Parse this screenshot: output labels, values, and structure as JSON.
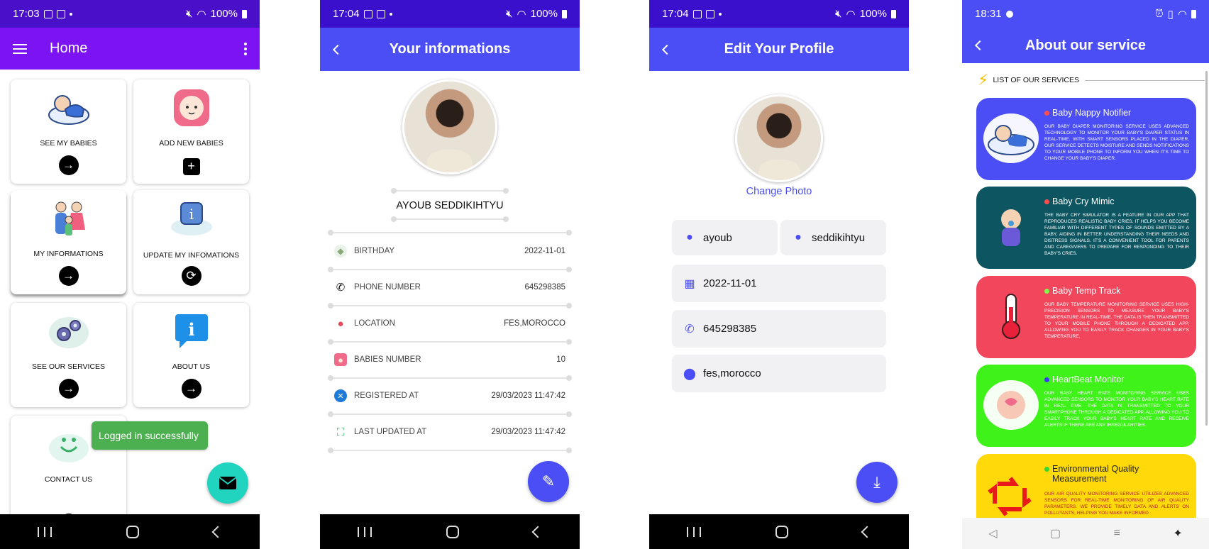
{
  "screen1": {
    "status": {
      "time": "17:03",
      "battery": "100%"
    },
    "title": "Home",
    "cards": [
      {
        "label": "SEE MY BABIES",
        "icon": "baby-sleeping-icon",
        "action": "arrow-right-icon"
      },
      {
        "label": "ADD NEW BABIES",
        "icon": "baby-face-icon",
        "action": "plus-box-icon"
      },
      {
        "label": "MY INFORMATIONS",
        "icon": "family-icon",
        "action": "arrow-right-icon"
      },
      {
        "label": "UPDATE MY INFOMATIONS",
        "icon": "info-cloud-icon",
        "action": "refresh-icon"
      },
      {
        "label": "SEE OUR SERVICES",
        "icon": "gears-cloud-icon",
        "action": "arrow-right-icon"
      },
      {
        "label": "ABOUT US",
        "icon": "info-bubble-icon",
        "action": "arrow-right-icon"
      },
      {
        "label": "CONTACT US",
        "icon": "smiley-cloud-icon",
        "action": "chat-icon"
      }
    ],
    "toast": "Logged in successfully"
  },
  "screen2": {
    "status": {
      "time": "17:04",
      "battery": "100%"
    },
    "title": "Your informations",
    "name": "AYOUB SEDDIKIHTYU",
    "rows": [
      {
        "label": "BIRTHDAY",
        "value": "2022-11-01",
        "icon": "cake-icon"
      },
      {
        "label": "PHONE NUMBER",
        "value": "645298385",
        "icon": "phone-icon"
      },
      {
        "label": "LOCATION",
        "value": "FES,MOROCCO",
        "icon": "location-pin-icon"
      },
      {
        "label": "BABIES NUMBER",
        "value": "10",
        "icon": "baby-face-icon"
      },
      {
        "label": "REGISTERED AT",
        "value": "29/03/2023 11:47:42",
        "icon": "register-icon"
      },
      {
        "label": "LAST UPDATED AT",
        "value": "29/03/2023 11:47:42",
        "icon": "update-icon"
      }
    ]
  },
  "screen3": {
    "status": {
      "time": "17:04",
      "battery": "100%"
    },
    "title": "Edit Your Profile",
    "change_photo": "Change Photo",
    "first_name": "ayoub",
    "last_name": "seddikihtyu",
    "birthday": "2022-11-01",
    "phone": "645298385",
    "location": "fes,morocco"
  },
  "screen4": {
    "status": {
      "time": "18:31"
    },
    "title": "About our service",
    "section_label": "LIST OF OUR SERVICES",
    "services": [
      {
        "title": "Baby Nappy Notifier",
        "bg": "#4a4ef4",
        "dot": "#ff4d4d",
        "text_color": "#ffffff",
        "desc": "Our baby diaper monitoring service uses advanced technology to monitor your baby's diaper status in real-time. With smart sensors placed in the diaper, our service detects moisture and sends notifications to your mobile phone to inform you when it's time to change your baby's diaper."
      },
      {
        "title": "Baby Cry Mimic",
        "bg": "#0d5560",
        "dot": "#ff4d4d",
        "text_color": "#ffffff",
        "desc": "The Baby Cry Simulator is a feature in our app that reproduces realistic baby cries. It helps you become familiar with different types of sounds emitted by a baby, aiding in better understanding their needs and distress signals. It's a convenient tool for parents and caregivers to prepare for responding to their baby's cries."
      },
      {
        "title": "Baby Temp Track",
        "bg": "#f2465d",
        "dot": "#7cff4a",
        "text_color": "#ffffff",
        "desc": "Our baby temperature monitoring service uses high-precision sensors to measure your baby's temperature in real-time. The data is then transmitted to your mobile phone through a dedicated app, allowing you to easily track changes in your baby's temperature."
      },
      {
        "title": "HeartBeat Monitor",
        "bg": "#3ef21a",
        "dot": "#3a3af5",
        "text_color": "#ffffff",
        "desc": "Our baby heart rate monitoring service uses advanced sensors to monitor your baby's heart rate in real time. The data is transmitted to your smartphone through a dedicated app, allowing you to easily track your baby's heart rate and receive alerts if there are any irregularities."
      },
      {
        "title": "Environmental Quality Measurement",
        "bg": "#ffd90a",
        "dot": "#37d634",
        "text_color": "#222222",
        "desc": "Our air quality monitoring service utilizes advanced sensors for real-time monitoring of air quality parameters. We provide timely data and alerts on pollutants, helping you make informed"
      }
    ]
  }
}
